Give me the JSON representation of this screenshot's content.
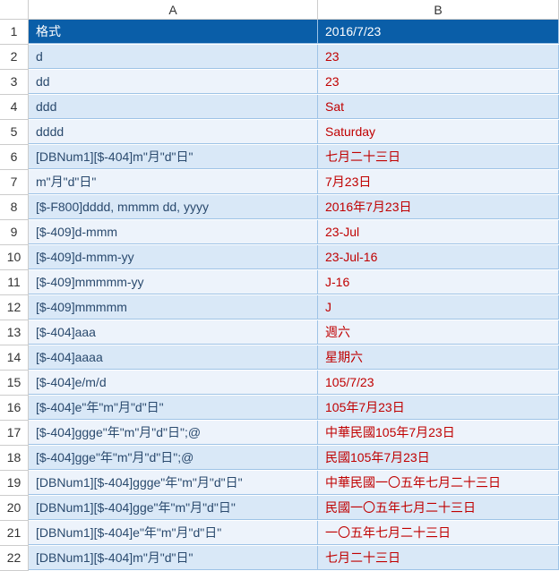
{
  "columns": {
    "A": "A",
    "B": "B"
  },
  "header": {
    "A": "格式",
    "B": "2016/7/23"
  },
  "rows": [
    {
      "num": "1"
    },
    {
      "num": "2",
      "A": "d",
      "B": "23"
    },
    {
      "num": "3",
      "A": "dd",
      "B": "23"
    },
    {
      "num": "4",
      "A": "ddd",
      "B": "Sat"
    },
    {
      "num": "5",
      "A": "dddd",
      "B": "Saturday"
    },
    {
      "num": "6",
      "A": "[DBNum1][$-404]m\"月\"d\"日\"",
      "B": "七月二十三日"
    },
    {
      "num": "7",
      "A": "m\"月\"d\"日\"",
      "B": "7月23日"
    },
    {
      "num": "8",
      "A": "[$-F800]dddd, mmmm dd, yyyy",
      "B": "2016年7月23日"
    },
    {
      "num": "9",
      "A": "[$-409]d-mmm",
      "B": "23-Jul"
    },
    {
      "num": "10",
      "A": "[$-409]d-mmm-yy",
      "B": "23-Jul-16"
    },
    {
      "num": "11",
      "A": "[$-409]mmmmm-yy",
      "B": "J-16"
    },
    {
      "num": "12",
      "A": "[$-409]mmmmm",
      "B": "J"
    },
    {
      "num": "13",
      "A": "[$-404]aaa",
      "B": "週六"
    },
    {
      "num": "14",
      "A": "[$-404]aaaa",
      "B": "星期六"
    },
    {
      "num": "15",
      "A": "[$-404]e/m/d",
      "B": "105/7/23"
    },
    {
      "num": "16",
      "A": "[$-404]e\"年\"m\"月\"d\"日\"",
      "B": "105年7月23日"
    },
    {
      "num": "17",
      "A": "[$-404]ggge\"年\"m\"月\"d\"日\";@",
      "B": "中華民國105年7月23日"
    },
    {
      "num": "18",
      "A": "[$-404]gge\"年\"m\"月\"d\"日\";@",
      "B": "民國105年7月23日"
    },
    {
      "num": "19",
      "A": "[DBNum1][$-404]ggge\"年\"m\"月\"d\"日\"",
      "B": "中華民國一〇五年七月二十三日"
    },
    {
      "num": "20",
      "A": "[DBNum1][$-404]gge\"年\"m\"月\"d\"日\"",
      "B": "民國一〇五年七月二十三日"
    },
    {
      "num": "21",
      "A": "[DBNum1][$-404]e\"年\"m\"月\"d\"日\"",
      "B": "一〇五年七月二十三日"
    },
    {
      "num": "22",
      "A": "[DBNum1][$-404]m\"月\"d\"日\"",
      "B": "七月二十三日"
    }
  ]
}
